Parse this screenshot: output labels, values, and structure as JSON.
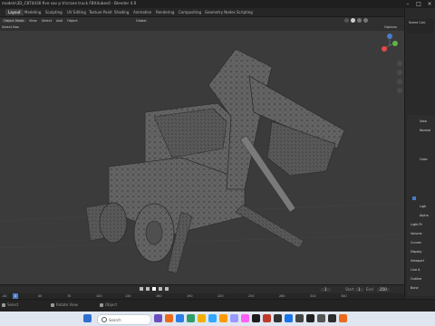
{
  "window": {
    "title": "models\\3D_C8T4430 five sav p tr\\crane truck FBX4ubes0 - Blender 4.0"
  },
  "workspace_tabs": [
    "Layout",
    "Modeling",
    "Sculpting",
    "UV Editing",
    "Texture Paint",
    "Shading",
    "Animation",
    "Rendering",
    "Compositing",
    "Geometry Nodes",
    "Scripting"
  ],
  "scene_label": "Scene",
  "viewport_header": {
    "mode": "Object Mode",
    "menus": [
      "View",
      "Select",
      "Add",
      "Object"
    ],
    "transform": "Global",
    "options": "Options"
  },
  "viewport_toolbar": {
    "select_box": "Select Box"
  },
  "right_panel_labels": [
    "Scene Coll.",
    "View",
    "Normal",
    "Color",
    "Ligh",
    "Alpha",
    "Light Pr",
    "Volume",
    "Curves",
    "Display",
    "Viewport",
    "Line A",
    "Outline",
    "Bone",
    "Freestyle",
    "Mesh",
    "Overlay"
  ],
  "timeline": {
    "current_frame": "1",
    "start": "1",
    "end": "250",
    "start_label": "Start",
    "end_label": "End",
    "ruler": [
      "-40",
      "0",
      "40",
      "70",
      "100",
      "130",
      "160",
      "190",
      "220",
      "250",
      "280",
      "310",
      "340"
    ]
  },
  "statusbar": {
    "left": "Select",
    "middle": "Rotate View",
    "right": "Object"
  },
  "taskbar": {
    "search_placeholder": "Search"
  },
  "colors": {
    "accent": "#4a7bc7",
    "viewport_bg": "#3b3b3b",
    "timeline_marker": "#4a7bc7",
    "taskbar_bg": "#dfe6ef"
  }
}
